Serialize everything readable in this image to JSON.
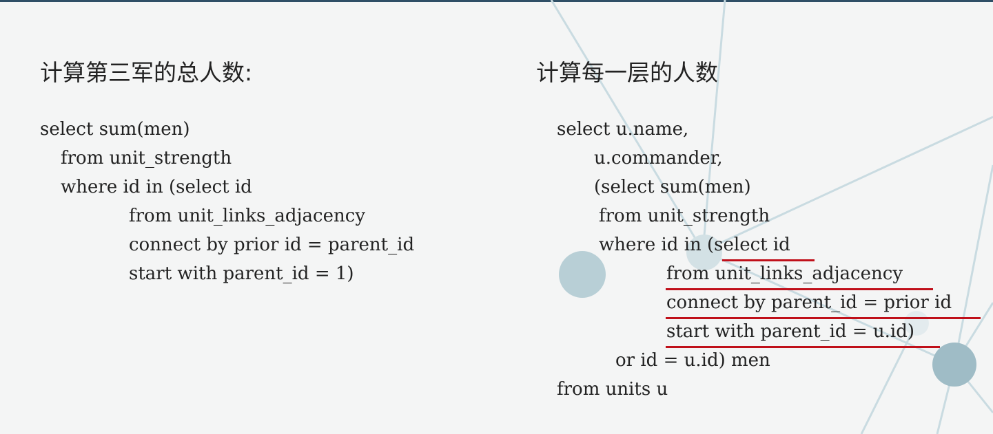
{
  "left": {
    "heading": "计算第三军的总人数:",
    "lines": [
      "select sum(men)",
      "from unit_strength",
      "where id in (select id",
      "from unit_links_adjacency",
      "connect by prior id = parent_id",
      "start with parent_id = 1)"
    ]
  },
  "right": {
    "heading": "计算每一层的人数",
    "lines": [
      "select u.name,",
      "u.commander,",
      "(select sum(men)",
      "from unit_strength",
      "where id in (select id",
      "from unit_links_adjacency",
      "connect by parent_id = prior id",
      "start with parent_id = u.id)",
      "or id = u.id) men",
      "from units u"
    ]
  },
  "colors": {
    "underline": "#c0101a",
    "text": "#222222",
    "decoration": "#9fbcc6"
  }
}
